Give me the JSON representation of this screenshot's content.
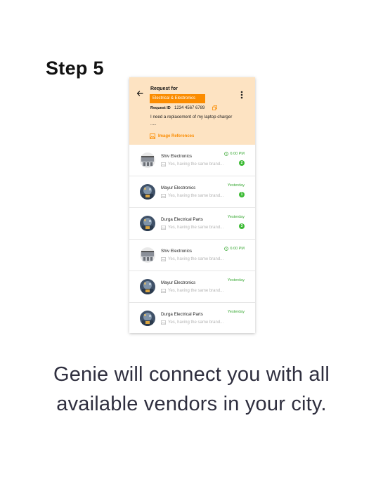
{
  "step_title": "Step 5",
  "request": {
    "title": "Request for",
    "category": "Electrical & Electronics",
    "id_label": "Request ID",
    "id_value": "1234 4567 6789",
    "description": "I need a replacement of my laptop charger .....",
    "image_refs_label": "Image References"
  },
  "vendors": [
    {
      "name": "Shiv Electronics",
      "message": "Yes, having the same brand...",
      "time": "6:00 PM",
      "show_clock": true,
      "unread": "2",
      "avatar": "shop"
    },
    {
      "name": "Mayur Electronics",
      "message": "Yes, having the same brand...",
      "time": "Yesterday",
      "show_clock": false,
      "unread": "1",
      "avatar": "store"
    },
    {
      "name": "Durga Electrical Parts",
      "message": "Yes, having the same brand...",
      "time": "Yesterday",
      "show_clock": false,
      "unread": "3",
      "avatar": "store"
    },
    {
      "name": "Shiv Electronics",
      "message": "Yes, having the same brand...",
      "time": "6:00 PM",
      "show_clock": true,
      "unread": "",
      "avatar": "shop"
    },
    {
      "name": "Mayur Electronics",
      "message": "Yes, having the same brand...",
      "time": "Yesterday",
      "show_clock": false,
      "unread": "",
      "avatar": "store"
    },
    {
      "name": "Durga Electrical Parts",
      "message": "Yes, having the same brand...",
      "time": "Yesterday",
      "show_clock": false,
      "unread": "",
      "avatar": "store"
    }
  ],
  "caption": {
    "line1": "Genie will connect you with all",
    "line2": "available vendors in your city."
  },
  "colors": {
    "header_bg": "#fde3c2",
    "accent": "#fb8c00",
    "time_green": "#3aa935",
    "badge_green": "#3dbb35"
  }
}
